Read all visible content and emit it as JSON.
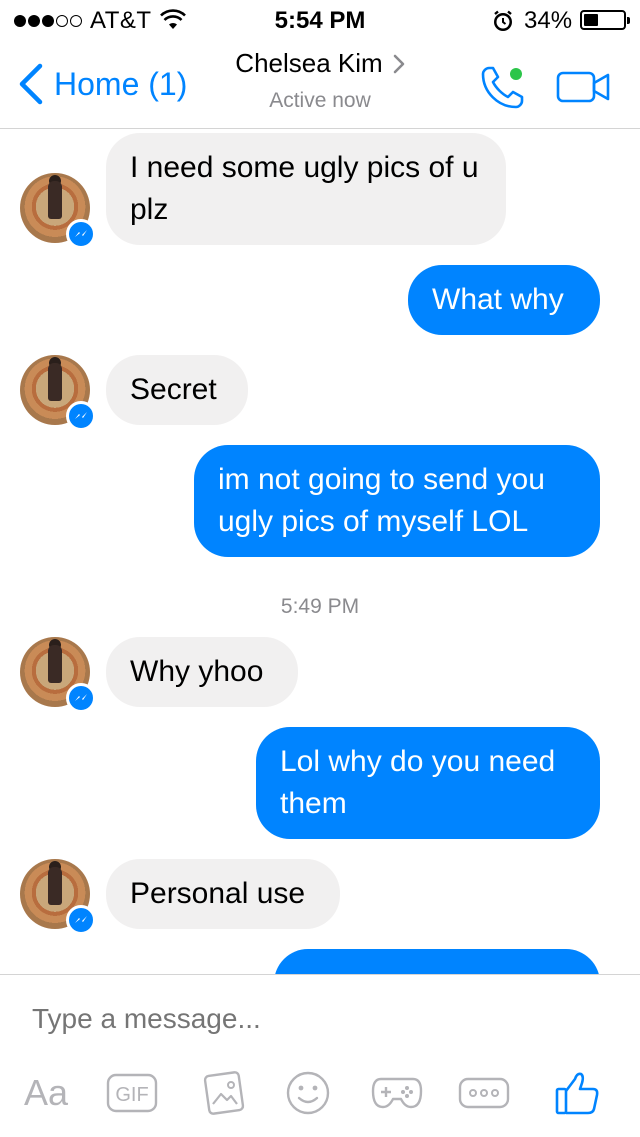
{
  "status_bar": {
    "carrier": "AT&T",
    "time": "5:54 PM",
    "battery": "34%",
    "battery_level": 0.34,
    "signal_bars_filled": 3,
    "signal_bars_total": 5
  },
  "nav": {
    "back_label": "Home (1)",
    "contact_name": "Chelsea Kim",
    "status": "Active now"
  },
  "messages": [
    {
      "direction": "incoming",
      "text": "I need some ugly pics of u plz"
    },
    {
      "direction": "outgoing",
      "text": "What why"
    },
    {
      "direction": "incoming",
      "text": "Secret"
    },
    {
      "direction": "outgoing",
      "text": "im not going to send you ugly pics of myself LOL"
    },
    {
      "timestamp": "5:49 PM"
    },
    {
      "direction": "incoming",
      "text": "Why yhoo"
    },
    {
      "direction": "outgoing",
      "text": "Lol why do you need them"
    },
    {
      "direction": "incoming",
      "text": "Personal use"
    }
  ],
  "timestamp": "5:49 PM",
  "composer": {
    "placeholder": "Type a message...",
    "aa_label": "Aa",
    "gif_label": "GIF"
  },
  "colors": {
    "accent": "#0084ff",
    "incoming_bubble": "#f1f0f0",
    "active_dot": "#2cc54a",
    "icon_gray": "#b4b4b8"
  }
}
